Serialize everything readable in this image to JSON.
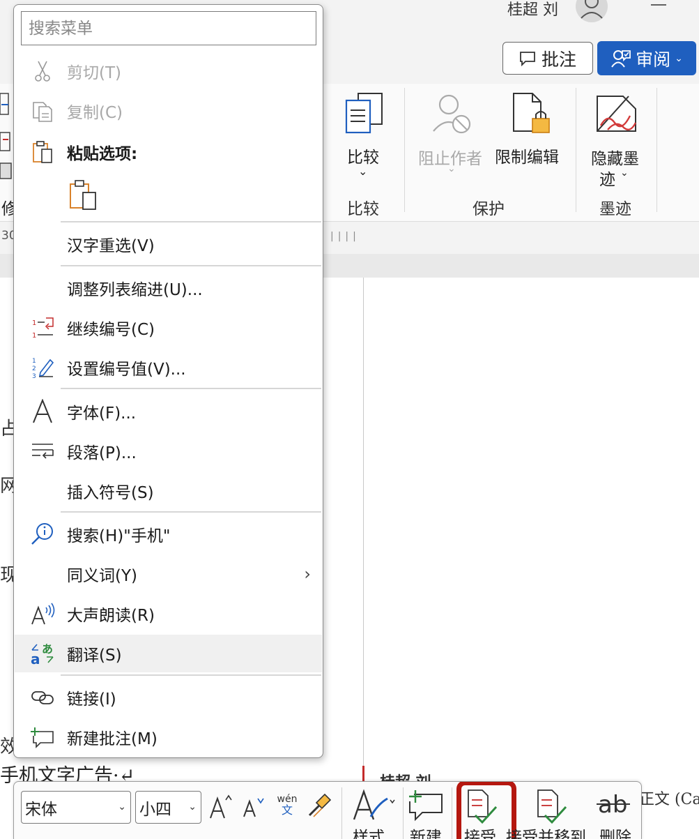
{
  "titlebar": {
    "user_name": "桂超 刘"
  },
  "ribbon_tabs": {
    "comment_button": "批注",
    "review_button": "审阅"
  },
  "ribbon": {
    "compare": {
      "button": "比较",
      "group": "比较"
    },
    "protect": {
      "block_authors": "阻止作者",
      "restrict_editing": "限制编辑",
      "group": "保护"
    },
    "ink": {
      "hide_ink_line1": "隐藏墨",
      "hide_ink_line2": "迹",
      "group": "墨迹"
    },
    "left_partial": {
      "ruler_number": "30",
      "edge_label": "修"
    }
  },
  "context_menu": {
    "search_placeholder": "搜索菜单",
    "items": [
      {
        "label": "剪切(T)",
        "icon": "scissors-icon",
        "disabled": true
      },
      {
        "label": "复制(C)",
        "icon": "copy-icon",
        "disabled": true
      },
      {
        "label": "粘贴选项:",
        "icon": "paste-icon",
        "bold": true
      },
      {
        "label": "汉字重选(V)"
      },
      {
        "label": "调整列表缩进(U)..."
      },
      {
        "label": "继续编号(C)",
        "icon": "continue-numbering-icon"
      },
      {
        "label": "设置编号值(V)...",
        "icon": "set-numbering-value-icon"
      },
      {
        "label": "字体(F)...",
        "icon": "font-icon"
      },
      {
        "label": "段落(P)...",
        "icon": "paragraph-icon"
      },
      {
        "label": "插入符号(S)"
      },
      {
        "label": "搜索(H)\"手机\"",
        "icon": "search-icon"
      },
      {
        "label": "同义词(Y)",
        "submenu": true
      },
      {
        "label": "大声朗读(R)",
        "icon": "read-aloud-icon"
      },
      {
        "label": "翻译(S)",
        "icon": "translate-icon",
        "hover": true
      },
      {
        "label": "链接(I)",
        "icon": "link-icon"
      },
      {
        "label": "新建批注(M)",
        "icon": "new-comment-icon"
      }
    ]
  },
  "document": {
    "edge_chars": [
      "占",
      "网",
      "现",
      "效"
    ],
    "line_text": "手机文字广告·↵",
    "comment_author": "桂超 刘",
    "side_text": "正文 (Ca"
  },
  "mini_toolbar": {
    "font_name": "宋体",
    "font_size": "小四",
    "phonetic_top": "wén",
    "phonetic_bottom": "文",
    "styles": "样式",
    "new_comment": "新建",
    "accept": "接受",
    "accept_and_move": "接受并移到",
    "delete": "删除"
  },
  "colors": {
    "review_button": "#1f5fbf",
    "highlight_box": "#b5170f",
    "paste_orange": "#d9822b",
    "tracked_change_red": "#c42b2b",
    "accept_green": "#2e8b3e"
  }
}
